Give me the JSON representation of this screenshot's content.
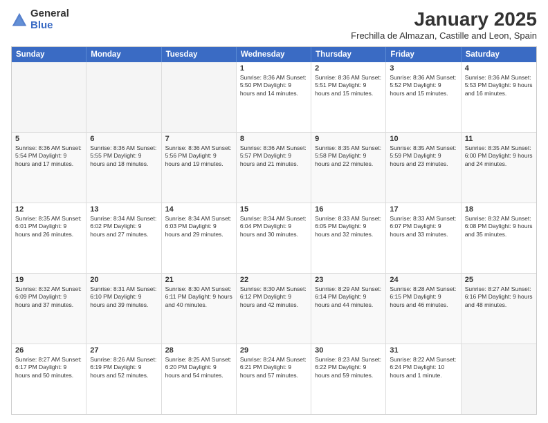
{
  "logo": {
    "general": "General",
    "blue": "Blue"
  },
  "title": "January 2025",
  "subtitle": "Frechilla de Almazan, Castille and Leon, Spain",
  "header_days": [
    "Sunday",
    "Monday",
    "Tuesday",
    "Wednesday",
    "Thursday",
    "Friday",
    "Saturday"
  ],
  "weeks": [
    [
      {
        "day": "",
        "info": "",
        "empty": true
      },
      {
        "day": "",
        "info": "",
        "empty": true
      },
      {
        "day": "",
        "info": "",
        "empty": true
      },
      {
        "day": "1",
        "info": "Sunrise: 8:36 AM\nSunset: 5:50 PM\nDaylight: 9 hours\nand 14 minutes.",
        "empty": false
      },
      {
        "day": "2",
        "info": "Sunrise: 8:36 AM\nSunset: 5:51 PM\nDaylight: 9 hours\nand 15 minutes.",
        "empty": false
      },
      {
        "day": "3",
        "info": "Sunrise: 8:36 AM\nSunset: 5:52 PM\nDaylight: 9 hours\nand 15 minutes.",
        "empty": false
      },
      {
        "day": "4",
        "info": "Sunrise: 8:36 AM\nSunset: 5:53 PM\nDaylight: 9 hours\nand 16 minutes.",
        "empty": false
      }
    ],
    [
      {
        "day": "5",
        "info": "Sunrise: 8:36 AM\nSunset: 5:54 PM\nDaylight: 9 hours\nand 17 minutes.",
        "empty": false
      },
      {
        "day": "6",
        "info": "Sunrise: 8:36 AM\nSunset: 5:55 PM\nDaylight: 9 hours\nand 18 minutes.",
        "empty": false
      },
      {
        "day": "7",
        "info": "Sunrise: 8:36 AM\nSunset: 5:56 PM\nDaylight: 9 hours\nand 19 minutes.",
        "empty": false
      },
      {
        "day": "8",
        "info": "Sunrise: 8:36 AM\nSunset: 5:57 PM\nDaylight: 9 hours\nand 21 minutes.",
        "empty": false
      },
      {
        "day": "9",
        "info": "Sunrise: 8:35 AM\nSunset: 5:58 PM\nDaylight: 9 hours\nand 22 minutes.",
        "empty": false
      },
      {
        "day": "10",
        "info": "Sunrise: 8:35 AM\nSunset: 5:59 PM\nDaylight: 9 hours\nand 23 minutes.",
        "empty": false
      },
      {
        "day": "11",
        "info": "Sunrise: 8:35 AM\nSunset: 6:00 PM\nDaylight: 9 hours\nand 24 minutes.",
        "empty": false
      }
    ],
    [
      {
        "day": "12",
        "info": "Sunrise: 8:35 AM\nSunset: 6:01 PM\nDaylight: 9 hours\nand 26 minutes.",
        "empty": false
      },
      {
        "day": "13",
        "info": "Sunrise: 8:34 AM\nSunset: 6:02 PM\nDaylight: 9 hours\nand 27 minutes.",
        "empty": false
      },
      {
        "day": "14",
        "info": "Sunrise: 8:34 AM\nSunset: 6:03 PM\nDaylight: 9 hours\nand 29 minutes.",
        "empty": false
      },
      {
        "day": "15",
        "info": "Sunrise: 8:34 AM\nSunset: 6:04 PM\nDaylight: 9 hours\nand 30 minutes.",
        "empty": false
      },
      {
        "day": "16",
        "info": "Sunrise: 8:33 AM\nSunset: 6:05 PM\nDaylight: 9 hours\nand 32 minutes.",
        "empty": false
      },
      {
        "day": "17",
        "info": "Sunrise: 8:33 AM\nSunset: 6:07 PM\nDaylight: 9 hours\nand 33 minutes.",
        "empty": false
      },
      {
        "day": "18",
        "info": "Sunrise: 8:32 AM\nSunset: 6:08 PM\nDaylight: 9 hours\nand 35 minutes.",
        "empty": false
      }
    ],
    [
      {
        "day": "19",
        "info": "Sunrise: 8:32 AM\nSunset: 6:09 PM\nDaylight: 9 hours\nand 37 minutes.",
        "empty": false
      },
      {
        "day": "20",
        "info": "Sunrise: 8:31 AM\nSunset: 6:10 PM\nDaylight: 9 hours\nand 39 minutes.",
        "empty": false
      },
      {
        "day": "21",
        "info": "Sunrise: 8:30 AM\nSunset: 6:11 PM\nDaylight: 9 hours\nand 40 minutes.",
        "empty": false
      },
      {
        "day": "22",
        "info": "Sunrise: 8:30 AM\nSunset: 6:12 PM\nDaylight: 9 hours\nand 42 minutes.",
        "empty": false
      },
      {
        "day": "23",
        "info": "Sunrise: 8:29 AM\nSunset: 6:14 PM\nDaylight: 9 hours\nand 44 minutes.",
        "empty": false
      },
      {
        "day": "24",
        "info": "Sunrise: 8:28 AM\nSunset: 6:15 PM\nDaylight: 9 hours\nand 46 minutes.",
        "empty": false
      },
      {
        "day": "25",
        "info": "Sunrise: 8:27 AM\nSunset: 6:16 PM\nDaylight: 9 hours\nand 48 minutes.",
        "empty": false
      }
    ],
    [
      {
        "day": "26",
        "info": "Sunrise: 8:27 AM\nSunset: 6:17 PM\nDaylight: 9 hours\nand 50 minutes.",
        "empty": false
      },
      {
        "day": "27",
        "info": "Sunrise: 8:26 AM\nSunset: 6:19 PM\nDaylight: 9 hours\nand 52 minutes.",
        "empty": false
      },
      {
        "day": "28",
        "info": "Sunrise: 8:25 AM\nSunset: 6:20 PM\nDaylight: 9 hours\nand 54 minutes.",
        "empty": false
      },
      {
        "day": "29",
        "info": "Sunrise: 8:24 AM\nSunset: 6:21 PM\nDaylight: 9 hours\nand 57 minutes.",
        "empty": false
      },
      {
        "day": "30",
        "info": "Sunrise: 8:23 AM\nSunset: 6:22 PM\nDaylight: 9 hours\nand 59 minutes.",
        "empty": false
      },
      {
        "day": "31",
        "info": "Sunrise: 8:22 AM\nSunset: 6:24 PM\nDaylight: 10 hours\nand 1 minute.",
        "empty": false
      },
      {
        "day": "",
        "info": "",
        "empty": true
      }
    ]
  ]
}
